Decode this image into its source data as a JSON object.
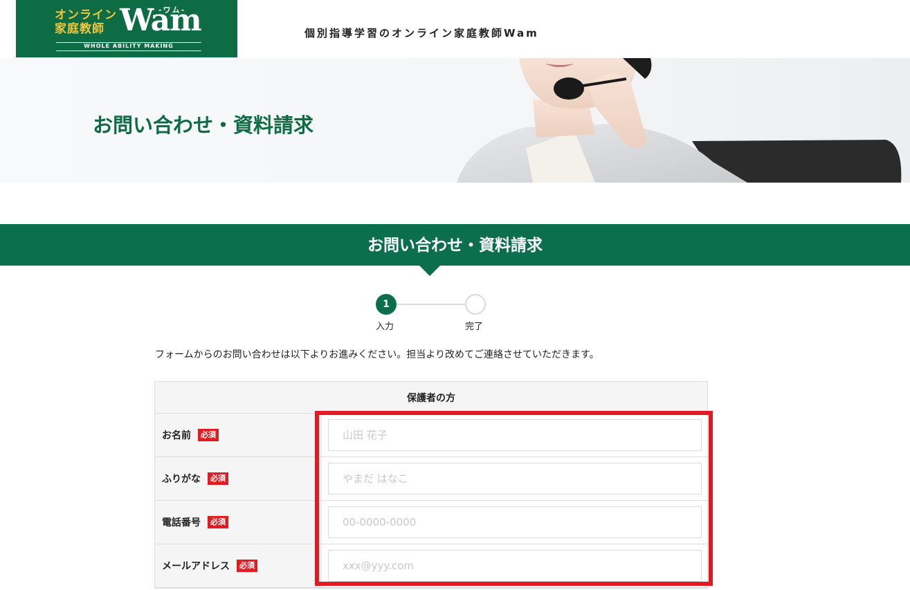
{
  "header": {
    "logo_jp_line1": "オンライン",
    "logo_jp_line2": "家庭教師",
    "logo_wordmark": "Wam",
    "logo_kana": "-ワム-",
    "logo_tagline": "WHOLE ABILITY MAKING",
    "site_title": "個別指導学習のオンライン家庭教師Wam"
  },
  "hero": {
    "title": "お問い合わせ・資料請求"
  },
  "section": {
    "title": "お問い合わせ・資料請求"
  },
  "steps": [
    {
      "number": "1",
      "label": "入力",
      "active": true
    },
    {
      "number": "",
      "label": "完了",
      "active": false
    }
  ],
  "intro_text": "フォームからのお問い合わせは以下よりお進みください。担当より改めてご連絡させていただきます。",
  "form": {
    "section_header": "保護者の方",
    "required_label": "必須",
    "fields": [
      {
        "label": "お名前",
        "placeholder": "山田 花子",
        "value": ""
      },
      {
        "label": "ふりがな",
        "placeholder": "やまだ はなこ",
        "value": ""
      },
      {
        "label": "電話番号",
        "placeholder": "00-0000-0000",
        "value": ""
      },
      {
        "label": "メールアドレス",
        "placeholder": "xxx@yyy.com",
        "value": ""
      }
    ]
  },
  "colors": {
    "brand_green": "#0b6f4d",
    "logo_gold": "#f0c63b",
    "required_red": "#e21b23",
    "highlight_red": "#e21b23"
  }
}
